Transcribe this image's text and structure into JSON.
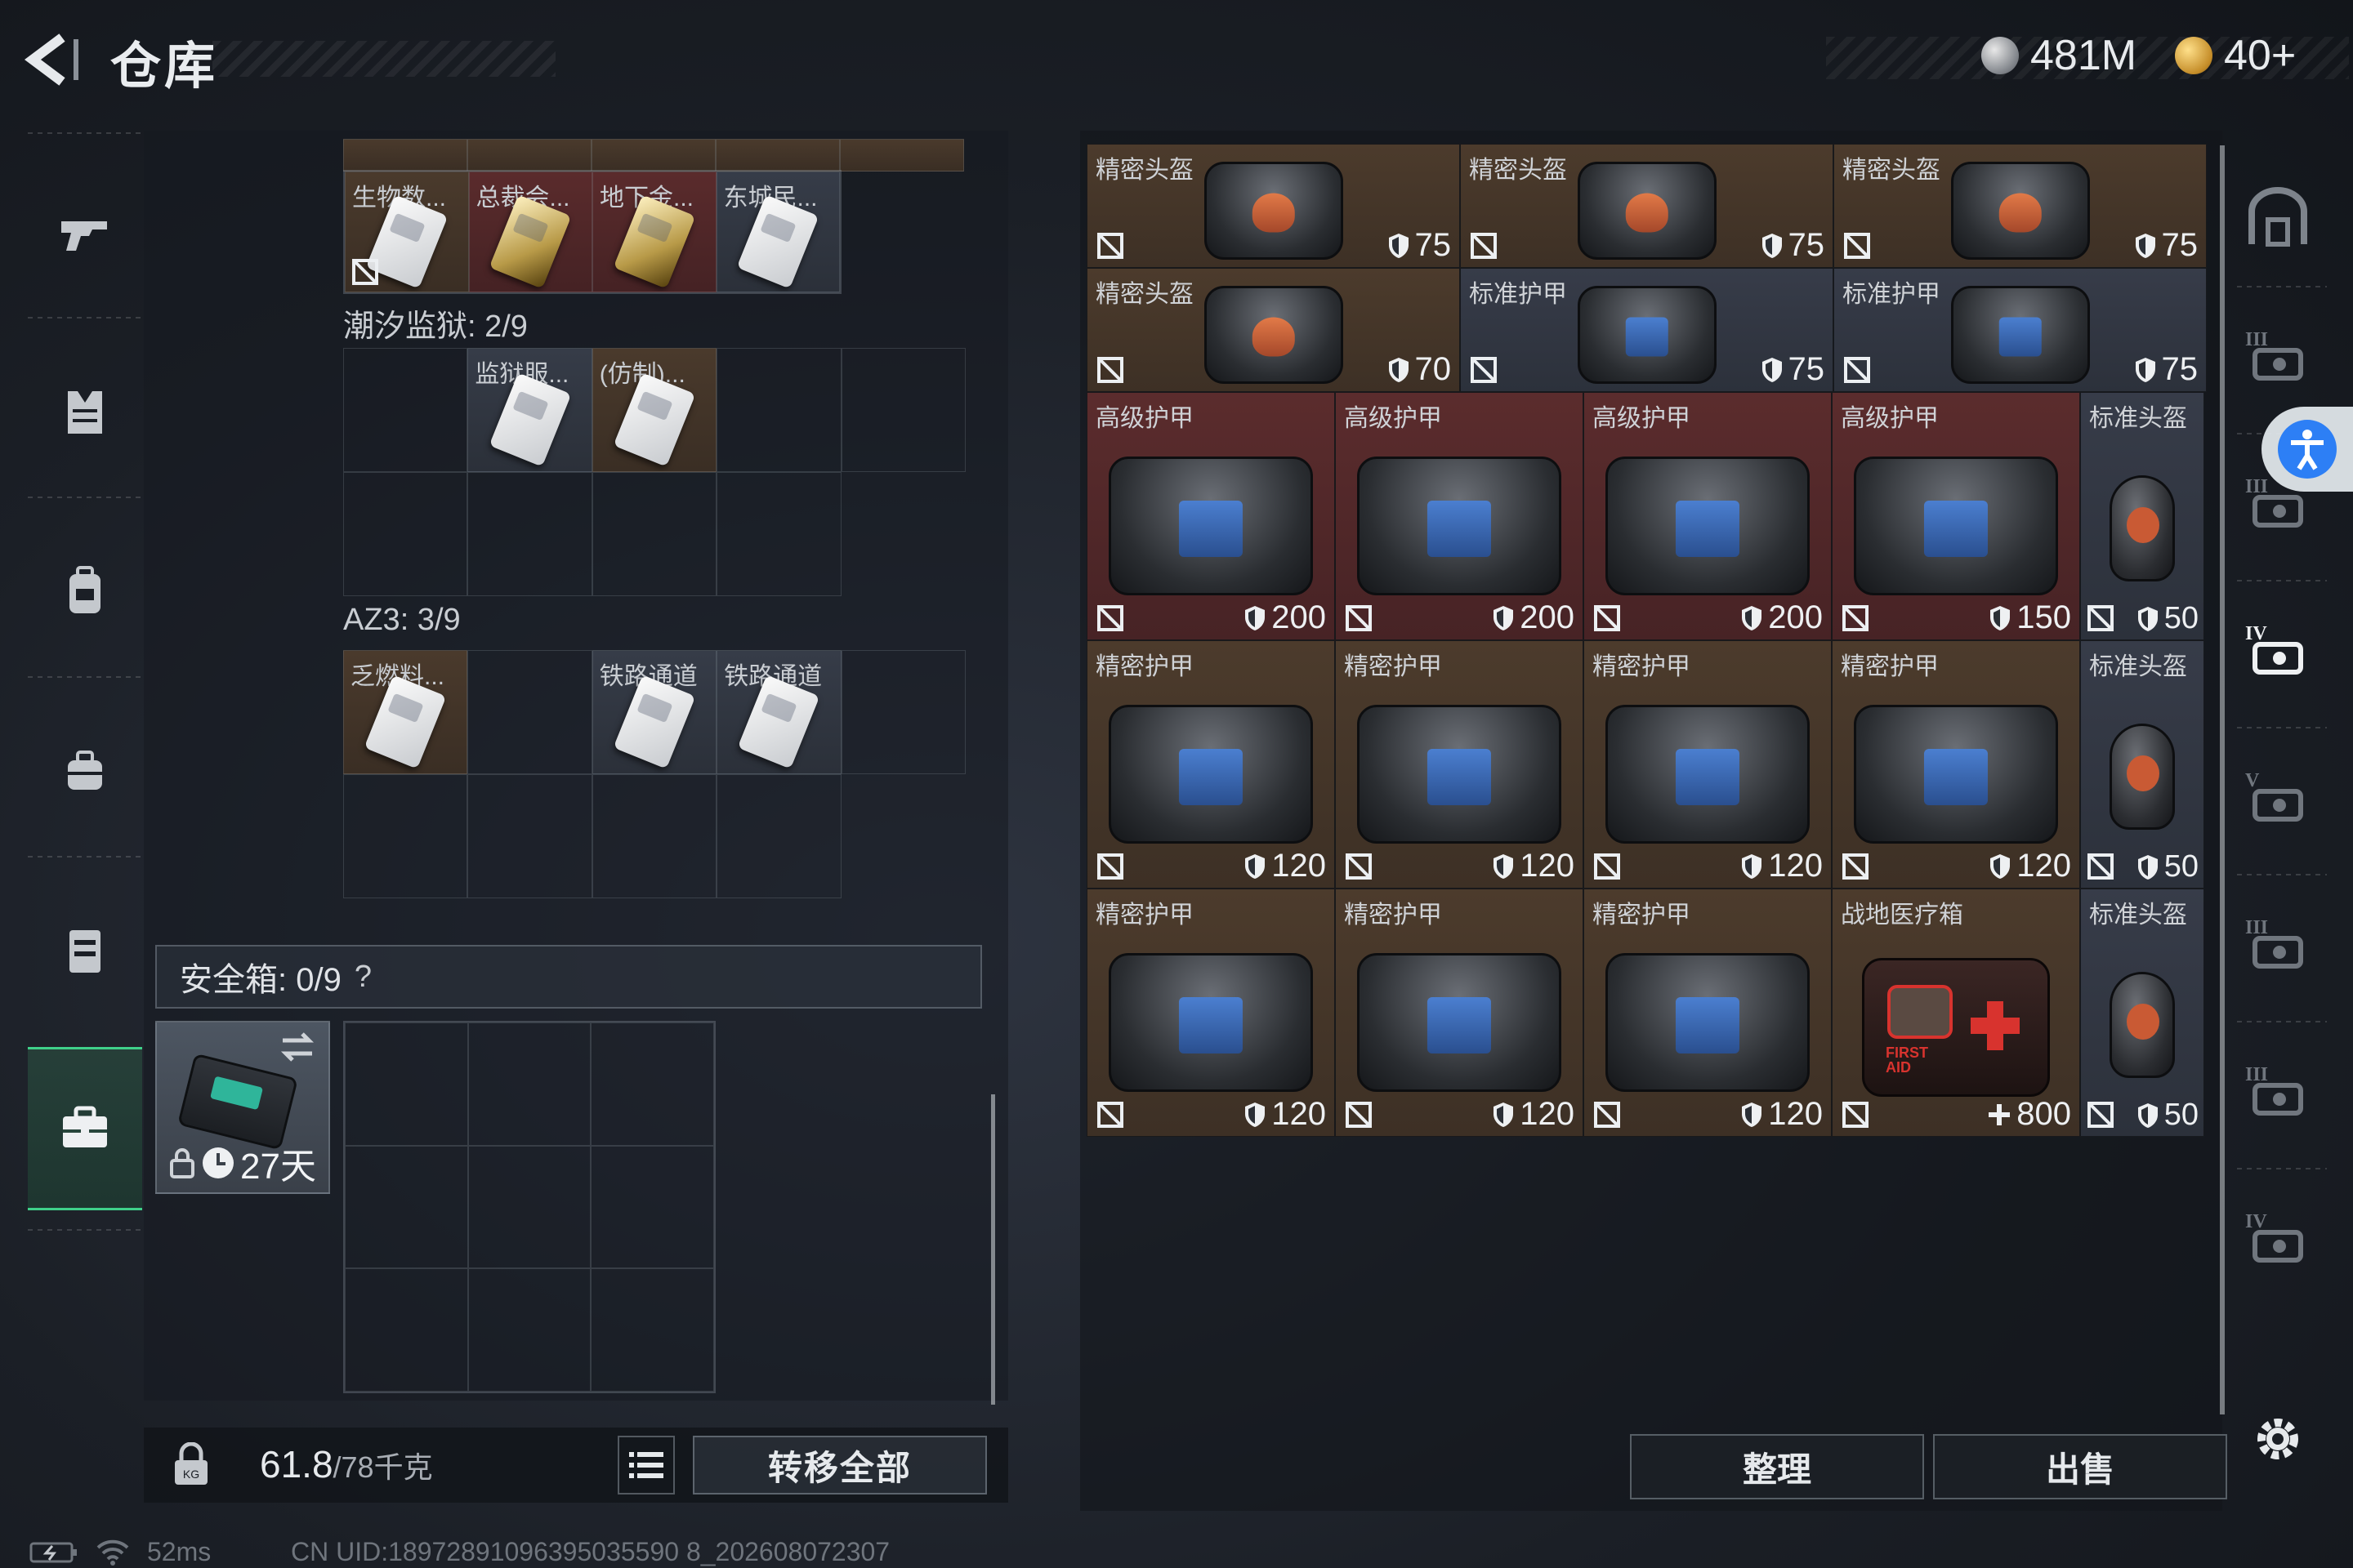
{
  "header": {
    "title": "仓库",
    "currency_silver": "481M",
    "currency_gold": "40+"
  },
  "left_panel": {
    "top_row_items": [
      {
        "name": "生物数...",
        "color": "brown",
        "card": "white",
        "no_trade": true
      },
      {
        "name": "总裁会...",
        "color": "red",
        "card": "gold",
        "no_trade": false
      },
      {
        "name": "地下金...",
        "color": "red",
        "card": "gold",
        "no_trade": false
      },
      {
        "name": "东城民...",
        "color": "gray",
        "card": "white",
        "no_trade": false
      }
    ],
    "section_tide": {
      "label": "潮汐监狱: 2/9",
      "items": [
        {
          "name": "监狱服...",
          "color": "gray"
        },
        {
          "name": "(仿制)...",
          "color": "brown"
        }
      ]
    },
    "section_az3": {
      "label": "AZ3: 3/9",
      "items": [
        {
          "name": "乏燃料...",
          "color": "brown"
        },
        {
          "name": "铁路通道",
          "color": "gray"
        },
        {
          "name": "铁路通道",
          "color": "gray"
        }
      ]
    },
    "safe_box": {
      "label": "安全箱: 0/9",
      "help": "?",
      "timer": "27天"
    },
    "footer": {
      "weight_current": "61.8",
      "weight_capacity": "/78千克",
      "transfer_all": "转移全部"
    }
  },
  "inventory": {
    "small_rows": [
      [
        {
          "name": "精密头盔",
          "value": "75",
          "color": "brown",
          "icon": "orange-vest"
        },
        {
          "name": "精密头盔",
          "value": "75",
          "color": "brown",
          "icon": "orange-vest"
        },
        {
          "name": "精密头盔",
          "value": "75",
          "color": "brown",
          "icon": "orange-vest"
        }
      ],
      [
        {
          "name": "精密头盔",
          "value": "70",
          "color": "brown",
          "icon": "orange-vest"
        },
        {
          "name": "标准护甲",
          "value": "75",
          "color": "gray",
          "icon": "blue-vest"
        },
        {
          "name": "标准护甲",
          "value": "75",
          "color": "gray",
          "icon": "blue-vest"
        }
      ]
    ],
    "big_rows": [
      [
        {
          "name": "高级护甲",
          "value": "200",
          "color": "red",
          "icon": "blue-vest"
        },
        {
          "name": "高级护甲",
          "value": "200",
          "color": "red",
          "icon": "blue-vest"
        },
        {
          "name": "高级护甲",
          "value": "200",
          "color": "red",
          "icon": "blue-vest"
        },
        {
          "name": "高级护甲",
          "value": "150",
          "color": "red",
          "icon": "blue-vest"
        },
        {
          "name": "标准头盔",
          "value": "50",
          "color": "gray",
          "icon": "helmet"
        }
      ],
      [
        {
          "name": "精密护甲",
          "value": "120",
          "color": "brown",
          "icon": "blue-vest"
        },
        {
          "name": "精密护甲",
          "value": "120",
          "color": "brown",
          "icon": "blue-vest"
        },
        {
          "name": "精密护甲",
          "value": "120",
          "color": "brown",
          "icon": "blue-vest"
        },
        {
          "name": "精密护甲",
          "value": "120",
          "color": "brown",
          "icon": "blue-vest"
        },
        {
          "name": "标准头盔",
          "value": "50",
          "color": "gray",
          "icon": "helmet"
        }
      ],
      [
        {
          "name": "精密护甲",
          "value": "120",
          "color": "brown",
          "icon": "blue-vest"
        },
        {
          "name": "精密护甲",
          "value": "120",
          "color": "brown",
          "icon": "blue-vest"
        },
        {
          "name": "精密护甲",
          "value": "120",
          "color": "brown",
          "icon": "blue-vest"
        },
        {
          "name": "战地医疗箱",
          "value": "800",
          "color": "brown",
          "icon": "medkit"
        },
        {
          "name": "标准头盔",
          "value": "50",
          "color": "gray",
          "icon": "helmet"
        }
      ]
    ],
    "medkit_label_1": "FIRST",
    "medkit_label_2": "AID"
  },
  "right_actions": {
    "sort": "整理",
    "sell": "出售"
  },
  "right_sidebar_levels": [
    "III",
    "III",
    "IV",
    "V",
    "III",
    "III",
    "IV"
  ],
  "status_bar": {
    "ping": "52ms",
    "uid": "CN UID:18972891096395035590 8_202608072307"
  },
  "colors": {
    "brown": "#4c3b2c",
    "red": "#5b2c2d",
    "gray": "#373c49",
    "accent_green": "#3fd08a",
    "accessibility_blue": "#2d7ff5"
  }
}
